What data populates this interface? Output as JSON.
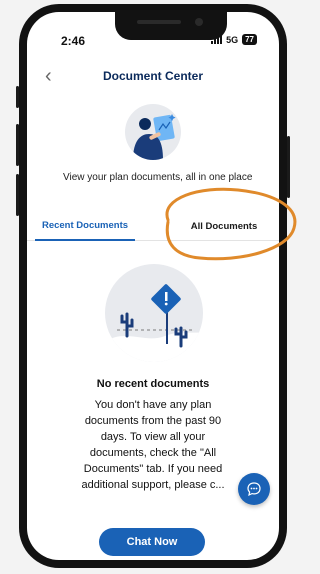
{
  "status_bar": {
    "time": "2:46",
    "network": "5G",
    "battery": "77"
  },
  "header": {
    "title": "Document Center",
    "back_icon": "chevron-left-icon"
  },
  "hero": {
    "subtitle": "View your plan documents, all in one place"
  },
  "tabs": [
    {
      "label": "Recent Documents",
      "active": true
    },
    {
      "label": "All Documents",
      "active": false
    }
  ],
  "empty_state": {
    "title": "No recent documents",
    "body": "You don't have any plan documents from the past 90 days. To view all your documents, check the \"All Documents\" tab. If you need additional support, please c..."
  },
  "chat_fab": {
    "icon": "chat-bubble-icon"
  },
  "cta": {
    "label": "Chat Now"
  },
  "colors": {
    "primary": "#1a62b6",
    "title": "#0b2a5b",
    "highlight": "#e08a2b"
  }
}
